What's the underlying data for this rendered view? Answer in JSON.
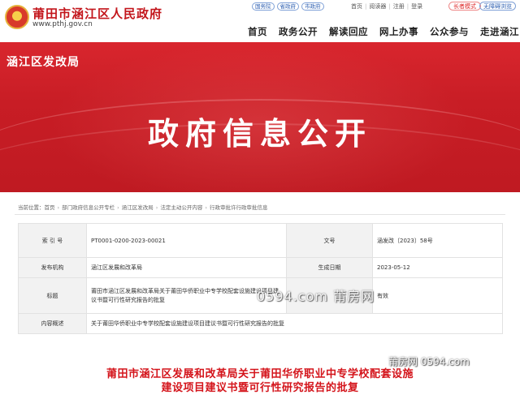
{
  "header": {
    "site_title": "莆田市涵江区人民政府",
    "site_url": "www.pthj.gov.cn",
    "top_links": [
      "国务院",
      "省政府",
      "市政府"
    ],
    "utility_links": [
      "首页",
      "阅读器",
      "注册",
      "登录"
    ],
    "elder_mode": "长者模式",
    "accessibility": "无障碍浏览"
  },
  "nav": [
    "首页",
    "政务公开",
    "解读回应",
    "网上办事",
    "公众参与",
    "走进涵江"
  ],
  "banner": {
    "dept_name": "涵江区发改局",
    "title": "政府信息公开"
  },
  "breadcrumb": {
    "prefix": "当前位置：",
    "items": [
      "首页",
      "部门政府信息公开专栏",
      "涵江区发改局",
      "法定主动公开内容",
      "行政审批许行政审批信息"
    ]
  },
  "meta": {
    "index_label": "索 引 号",
    "index_value": "PT0001-0200-2023-00021",
    "docno_label": "文号",
    "docno_value": "涵发改〔2023〕58号",
    "issuer_label": "发布机构",
    "issuer_value": "涵江区发展和改革局",
    "date_label": "生成日期",
    "date_value": "2023-05-12",
    "title_label": "标题",
    "title_value": "莆田市涵江区发展和改革局关于莆田华侨职业中专学校配套设施建设项目建议书暨可行性研究报告的批复",
    "validity_value": "有效",
    "summary_label": "内容概述",
    "summary_value": "关于莆田华侨职业中专学校配套设施建设项目建议书暨可行性研究报告的批复"
  },
  "watermarks": {
    "center": "0594.com 莆房网",
    "corner": "莆房网 0594.com"
  },
  "document": {
    "title_line1": "莆田市涵江区发展和改革局关于莆田华侨职业中专学校配套设施",
    "title_line2": "建设项目建议书暨可行性研究报告的批复"
  },
  "colors": {
    "brand_red": "#c81d25",
    "title_red": "#d4141b",
    "link_blue": "#2a5db0"
  }
}
